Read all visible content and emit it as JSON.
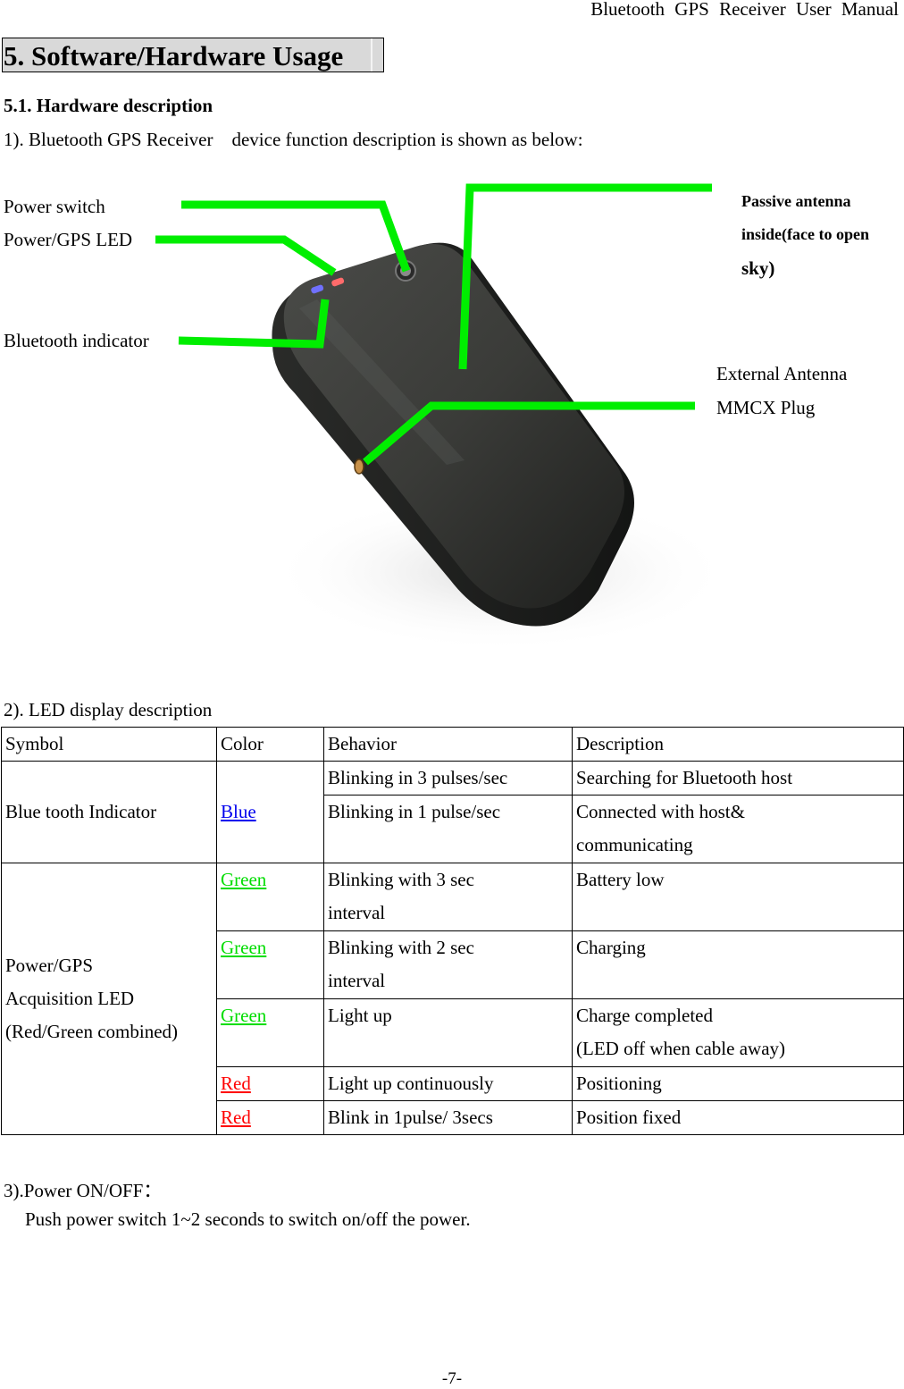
{
  "running_header": "Bluetooth GPS Receiver User Manual",
  "chapter": {
    "title": "5. Software/Hardware Usage"
  },
  "section": {
    "title": "5.1. Hardware description",
    "intro": "1). Bluetooth GPS Receiver    device function description is shown as below:"
  },
  "figure": {
    "callouts": {
      "power_switch": "Power switch",
      "power_gps_led": "Power/GPS LED",
      "bluetooth_indicator": "Bluetooth indicator",
      "passive_antenna_line1": "Passive antenna",
      "passive_antenna_line2": "inside(face to open",
      "passive_antenna_line3": "sky)",
      "external_antenna_line1": "External Antenna",
      "external_antenna_line2": "MMCX Plug"
    },
    "colors": {
      "callout_line": "#00ee00",
      "device_body": "#3a3b38",
      "led_red": "#ff6b6b",
      "led_blue": "#7070ff"
    }
  },
  "led_section": {
    "title": "2). LED display description",
    "headers": [
      "Symbol",
      "Color",
      "Behavior",
      "Description"
    ],
    "groups": [
      {
        "symbol": "Blue tooth Indicator",
        "color": "Blue",
        "color_hex": "#0000ee",
        "rows": [
          {
            "behavior": "Blinking in 3 pulses/sec",
            "description": "Searching for Bluetooth host"
          },
          {
            "behavior": "Blinking in 1 pulse/sec",
            "description_line1": "Connected with host&",
            "description_line2": "communicating"
          }
        ]
      },
      {
        "symbol_line1": "Power/GPS",
        "symbol_line2": "Acquisition LED",
        "symbol_line3": "(Red/Green combined)",
        "rows": [
          {
            "color": "Green",
            "color_hex": "#00dd00",
            "behavior_line1": "Blinking with 3 sec",
            "behavior_line2": "interval",
            "description": "Battery low"
          },
          {
            "color": "Green",
            "color_hex": "#00dd00",
            "behavior_line1": "Blinking with 2 sec",
            "behavior_line2": "interval",
            "description": "Charging"
          },
          {
            "color": "Green",
            "color_hex": "#00dd00",
            "behavior": "Light up",
            "description_line1": "Charge completed",
            "description_line2": "(LED off when cable away)"
          },
          {
            "color": "Red",
            "color_hex": "#ff0000",
            "behavior": "Light up continuously",
            "description": "Positioning"
          },
          {
            "color": "Red",
            "color_hex": "#ff0000",
            "behavior": "Blink in 1pulse/ 3secs",
            "description": "Position fixed"
          }
        ]
      }
    ]
  },
  "power_section": {
    "title": "3).Power ON/OFF：",
    "body": "Push power switch 1~2 seconds to switch on/off the power."
  },
  "page_number": "-7-"
}
